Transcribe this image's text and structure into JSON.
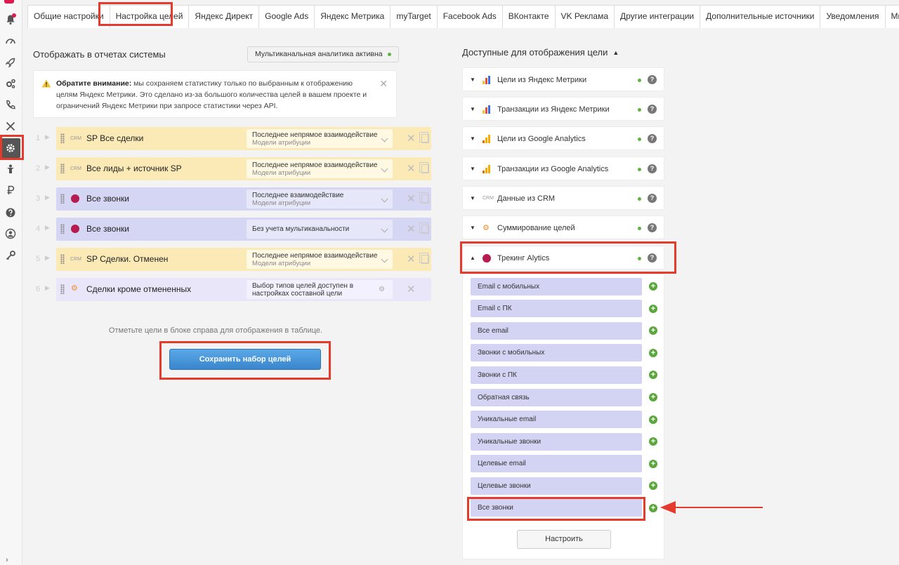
{
  "tabs": [
    "Общие настройки",
    "Настройка целей",
    "Яндекс Директ",
    "Google Ads",
    "Яндекс Метрика",
    "myTarget",
    "Facebook Ads",
    "ВКонтакте",
    "VK Реклама",
    "Другие интеграции",
    "Дополнительные источники",
    "Уведомления",
    "Множители"
  ],
  "active_tab": "Настройка целей",
  "left": {
    "title": "Отображать в отчетах системы",
    "multichannel_label": "Мультиканальная аналитика активна",
    "warning_bold": "Обратите внимание:",
    "warning_text": " мы сохраняем статистику только по выбранным к отображению целям Яндекс Метрики. Это сделано из-за большого количества целей в вашем проекте и ограничений Яндекс Метрики при запросе статистики через API.",
    "rows": [
      {
        "num": "1",
        "icon": "CRM",
        "name": "SP Все сделки",
        "attr": "Последнее непрямое взаимодействие",
        "sub": "Модели атрибуции"
      },
      {
        "num": "2",
        "icon": "CRM",
        "name": "Все лиды + источник SP",
        "attr": "Последнее непрямое взаимодействие",
        "sub": "Модели атрибуции"
      },
      {
        "num": "3",
        "icon": "alytics-icon",
        "name": "Все звонки",
        "attr": "Последнее взаимодействие",
        "sub": "Модели атрибуции"
      },
      {
        "num": "4",
        "icon": "alytics-icon",
        "name": "Все звонки",
        "attr": "Без учета мультиканальности",
        "sub": ""
      },
      {
        "num": "5",
        "icon": "CRM",
        "name": "SP Сделки. Отменен",
        "attr": "Последнее непрямое взаимодействие",
        "sub": "Модели атрибуции"
      },
      {
        "num": "6",
        "icon": "sum-icon",
        "name": "Сделки кроме отмененных",
        "attr": "Выбор типов целей доступен в",
        "sub": "настройках составной цели"
      }
    ],
    "hint": "Отметьте цели в блоке справа для отображения в таблице.",
    "save_label": "Сохранить набор целей"
  },
  "right": {
    "title": "Доступные для отображения цели",
    "groups": [
      {
        "name": "Цели из Яндекс Метрики",
        "icon": "metrika-icon"
      },
      {
        "name": "Транзакции из Яндекс Метрики",
        "icon": "metrika-icon"
      },
      {
        "name": "Цели из Google Analytics",
        "icon": "ga-icon"
      },
      {
        "name": "Транзакции из Google Analytics",
        "icon": "ga-icon"
      },
      {
        "name": "Данные из CRM",
        "icon": "CRM"
      },
      {
        "name": "Суммирование целей",
        "icon": "sum-icon"
      },
      {
        "name": "Трекинг Alytics",
        "icon": "alytics-icon"
      }
    ],
    "items": [
      "Email с мобильных",
      "Email с ПК",
      "Все email",
      "Звонки с мобильных",
      "Звонки с ПК",
      "Обратная связь",
      "Уникальные email",
      "Уникальные звонки",
      "Целевые email",
      "Целевые звонки",
      "Все звонки"
    ],
    "configure_label": "Настроить"
  },
  "colors": {
    "accent_red": "#e53b2c",
    "yellow_row": "#fbe9b6",
    "purple_row": "#d5d6f3",
    "green": "#5ba63d",
    "save_blue": "#3a85cc"
  }
}
